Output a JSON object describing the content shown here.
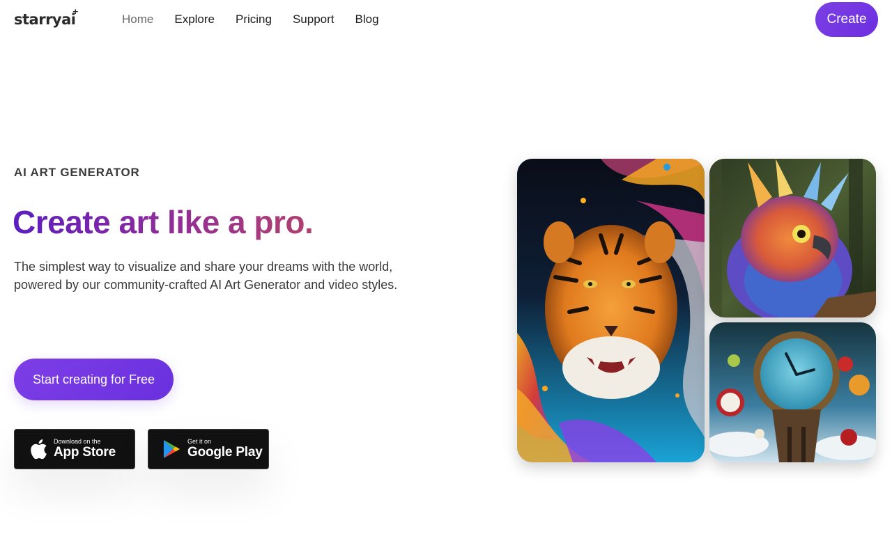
{
  "brand": {
    "logo_text": "starryai",
    "logo_mark": "+"
  },
  "nav": {
    "links": [
      {
        "label": "Home",
        "active": true
      },
      {
        "label": "Explore"
      },
      {
        "label": "Pricing"
      },
      {
        "label": "Support"
      },
      {
        "label": "Blog"
      }
    ],
    "create_label": "Create"
  },
  "hero": {
    "eyebrow": "AI ART GENERATOR",
    "headline": "Create art like a pro.",
    "subtext": "The simplest way to visualize and share your dreams with the world, powered by our community-crafted AI Art Generator and video styles.",
    "cta_label": "Start creating for Free"
  },
  "stores": {
    "apple": {
      "small": "Download on the",
      "big": "App Store",
      "icon": "apple-icon"
    },
    "google": {
      "small": "Get it on",
      "big": "Google Play",
      "icon": "google-play-icon"
    }
  },
  "gallery": [
    {
      "name": "tiger-artwork"
    },
    {
      "name": "bird-artwork"
    },
    {
      "name": "clock-artwork"
    }
  ],
  "colors": {
    "accent": "#7b3fe4",
    "headline_gradient_start": "#5b1fbf",
    "headline_gradient_end": "#b2416f"
  }
}
